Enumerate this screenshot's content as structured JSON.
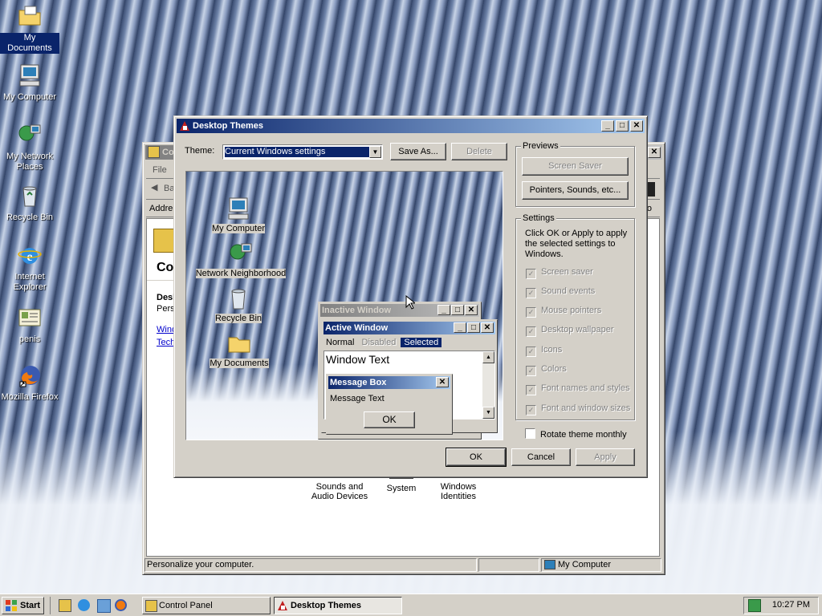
{
  "desktop": {
    "icons": [
      {
        "label": "My Documents",
        "icon": "folder-documents-icon"
      },
      {
        "label": "My Computer",
        "icon": "computer-icon"
      },
      {
        "label": "My Network Places",
        "icon": "network-icon"
      },
      {
        "label": "Recycle Bin",
        "icon": "recycle-bin-icon"
      },
      {
        "label": "Internet Explorer",
        "icon": "ie-icon"
      },
      {
        "label": "penis",
        "icon": "card-icon"
      },
      {
        "label": "Mozilla Firefox",
        "icon": "firefox-icon"
      }
    ]
  },
  "control_panel": {
    "title": "Co",
    "menu_file": "File",
    "back": "Ba",
    "address": "Addre",
    "heading": "Co",
    "desc_title": "Desk",
    "desc_sub": "Perso",
    "link1": "Wind",
    "link2": "Tech",
    "right_edge": "o",
    "items": [
      {
        "label": "Sounds and Audio Devices"
      },
      {
        "label": "System"
      },
      {
        "label": "Windows Identities"
      }
    ],
    "status_text": "Personalize your computer.",
    "status_zone": "My Computer"
  },
  "dialog": {
    "title": "Desktop Themes",
    "theme_label": "Theme:",
    "theme_value": "Current Windows settings",
    "save_as": "Save As...",
    "delete": "Delete",
    "previews_label": "Previews",
    "screen_saver_btn": "Screen Saver",
    "pointers_btn": "Pointers, Sounds, etc...",
    "settings_label": "Settings",
    "settings_text": "Click OK or Apply to apply the selected settings to Windows.",
    "checks": [
      "Screen saver",
      "Sound events",
      "Mouse pointers",
      "Desktop wallpaper",
      "Icons",
      "Colors",
      "Font names and styles",
      "Font and window sizes"
    ],
    "rotate": "Rotate theme monthly",
    "ok": "OK",
    "cancel": "Cancel",
    "apply": "Apply"
  },
  "preview": {
    "icons": [
      "My Computer",
      "Network Neighborhood",
      "Recycle Bin",
      "My Documents"
    ],
    "inactive_title": "Inactive Window",
    "active_title": "Active Window",
    "menu_normal": "Normal",
    "menu_disabled": "Disabled",
    "menu_selected": "Selected",
    "window_text": "Window Text",
    "msgbox_title": "Message Box",
    "msgbox_text": "Message Text",
    "msgbox_ok": "OK"
  },
  "taskbar": {
    "start": "Start",
    "tasks": [
      {
        "label": "Control Panel",
        "active": false
      },
      {
        "label": "Desktop Themes",
        "active": true
      }
    ],
    "clock": "10:27 PM"
  },
  "colors": {
    "title_active_start": "#0a246a",
    "title_active_end": "#a6caf0",
    "face": "#d4d0c8",
    "selection": "#0a246a"
  }
}
